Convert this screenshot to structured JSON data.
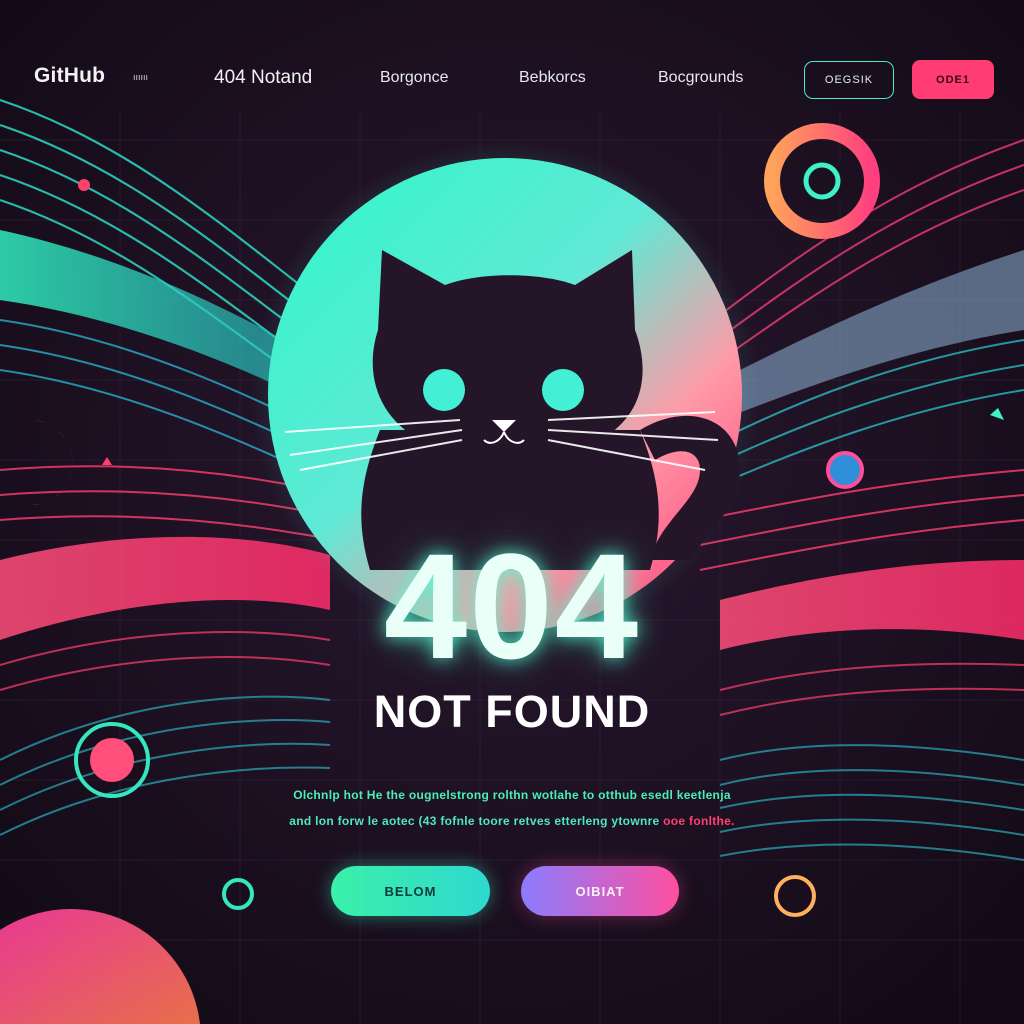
{
  "nav": {
    "brand": "GitHub",
    "brand_small": "ıııııı",
    "links": [
      "404 Notand",
      "Borgonce",
      "Bebkorcs",
      "Bocgrounds"
    ],
    "outline_button": "OEGSIK",
    "fill_button": "ODE1"
  },
  "hero": {
    "code": "404",
    "title": "NOT FOUND",
    "desc_line1": "Olchnlp hot He the ougnelstrong rolthn wotlahe to otthub esedl keetlenja",
    "desc_line2_main": "and lon forw le aotec (43 fofnle toore retves etterleng ytownre",
    "desc_line2_highlight": "ooe fonlthe."
  },
  "cta": {
    "primary": "BELOM",
    "secondary": "OIBIAT"
  },
  "colors": {
    "background": "#1a0f1f",
    "accent_teal": "#43f0c8",
    "accent_pink": "#ff3d72",
    "accent_purple": "#8a7cff"
  },
  "icons": {
    "hero_illustration": "cat-silhouette-icon"
  }
}
